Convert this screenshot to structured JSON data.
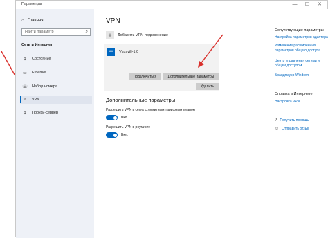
{
  "window": {
    "title": "Параметры",
    "controls": [
      "—",
      "☐",
      "✕"
    ]
  },
  "sidebar": {
    "home_label": "Главная",
    "search_placeholder": "Найти параметр",
    "section_title": "Сеть и Интернет",
    "items": [
      {
        "label": "Состояние",
        "icon": "globe-icon"
      },
      {
        "label": "Ethernet",
        "icon": "ethernet-icon"
      },
      {
        "label": "Набор номера",
        "icon": "phone-icon"
      },
      {
        "label": "VPN",
        "icon": "vpn-icon",
        "active": true
      },
      {
        "label": "Прокси-сервер",
        "icon": "globe-icon"
      }
    ]
  },
  "main": {
    "title": "VPN",
    "add_label": "Добавить VPN-подключение",
    "connection": {
      "name": "Vkusvill-1.0",
      "connect_label": "Подключиться",
      "advanced_label": "Дополнительные параметры",
      "delete_label": "Удалить"
    },
    "advanced_title": "Дополнительные параметры",
    "options": [
      {
        "label": "Разрешить VPN в сетях с лимитным тарифным планом",
        "state": "Вкл."
      },
      {
        "label": "Разрешить VPN в роуминге",
        "state": "Вкл."
      }
    ]
  },
  "right": {
    "related_title": "Сопутствующие параметры",
    "related_links": [
      "Настройка параметров адаптера",
      "Изменение расширенных параметров общего доступа",
      "Центр управления сетями и общим доступом",
      "Брандмауэр Windows"
    ],
    "internet_help_title": "Справка в Интернете",
    "internet_help_link": "Настройка VPN",
    "help_items": [
      "Получить помощь",
      "Отправить отзыв"
    ]
  },
  "colors": {
    "accent": "#0067c0",
    "arrow": "#d9302c",
    "sidebar_bg": "#eef1f7"
  }
}
